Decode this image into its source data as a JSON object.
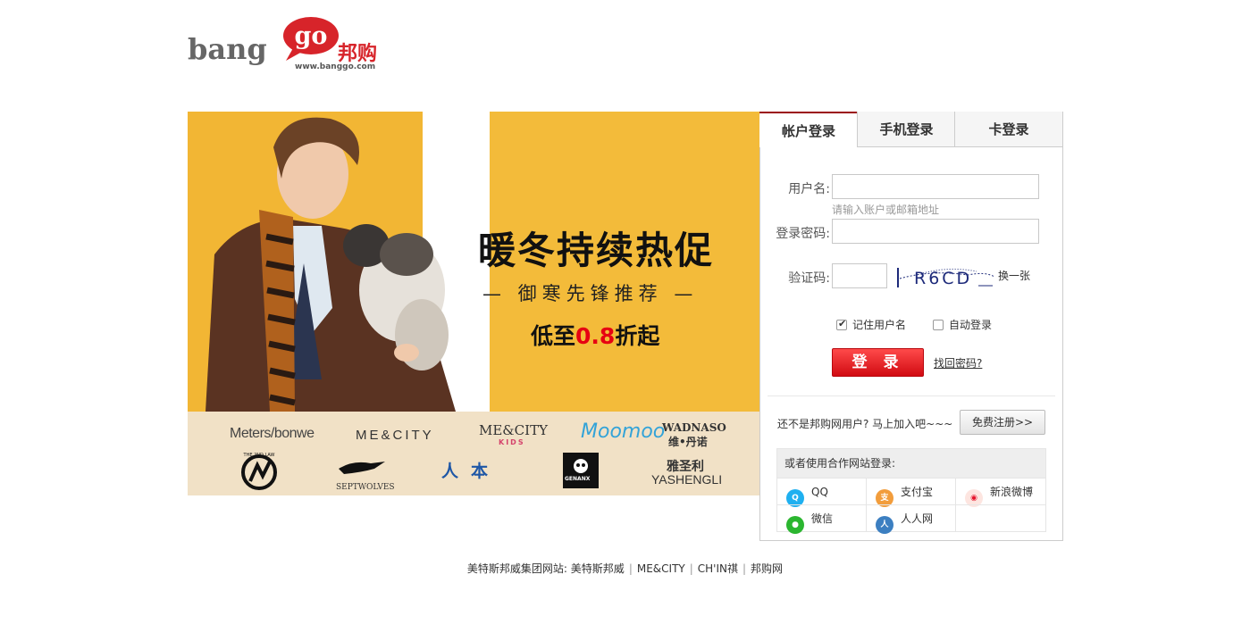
{
  "logo": {
    "wordmark": "bang",
    "bubble_text": "go",
    "chinese": "邦购",
    "url": "www.banggo.com"
  },
  "banner": {
    "headline": "暖冬持续热促",
    "subtitle": "— 御寒先锋推荐 —",
    "price_prefix": "低至",
    "price_value": "0.8",
    "price_suffix": "折起",
    "colors": {
      "background": "#f2b634",
      "accent": "#e60012"
    }
  },
  "brands": {
    "metersbonwe": "Meters/bonwe",
    "mecity": "ME&CITY",
    "mecity_kids_top": "ME&CITY",
    "mecity_kids_bottom": "KIDS",
    "moomoo": "Moomoo",
    "wadnaso_top": "WADNASO",
    "wadnaso_bottom": "维•丹诺",
    "the2ndlaw": "THE 2ND LAW",
    "septwolves": "SEPTWOLVES",
    "renben": "人本",
    "genanx": "GENANX",
    "yashengli_cn": "雅圣利",
    "yashengli_en": "YASHENGLI"
  },
  "login": {
    "tabs": [
      {
        "label": "帐户登录",
        "active": true
      },
      {
        "label": "手机登录",
        "active": false
      },
      {
        "label": "卡登录",
        "active": false
      }
    ],
    "username": {
      "label": "用户名:",
      "value": "",
      "hint": "请输入账户或邮箱地址"
    },
    "password": {
      "label": "登录密码:",
      "value": ""
    },
    "captcha": {
      "label": "验证码:",
      "value": "",
      "image_text": "R6CD",
      "refresh": "换一张"
    },
    "remember": {
      "label": "记住用户名",
      "checked": true
    },
    "autologin": {
      "label": "自动登录",
      "checked": false
    },
    "submit": "登 录",
    "forgot": "找回密码?",
    "register_prompt": "还不是邦购网用户? 马上加入吧~~~",
    "register_button": "免费注册>>",
    "partners_title": "或者使用合作网站登录:",
    "partners": [
      {
        "label": "QQ",
        "icon": "qq-icon",
        "color": "#1fb0f0"
      },
      {
        "label": "支付宝",
        "icon": "alipay-icon",
        "color": "#f29d3c"
      },
      {
        "label": "新浪微博",
        "icon": "weibo-icon",
        "color": "#e6162d"
      },
      {
        "label": "微信",
        "icon": "wechat-icon",
        "color": "#2bb630"
      },
      {
        "label": "人人网",
        "icon": "renren-icon",
        "color": "#3c7fc1"
      }
    ]
  },
  "footer": {
    "prefix": "美特斯邦威集团网站:",
    "links": [
      "美特斯邦威",
      "ME&CITY",
      "CH'IN祺",
      "邦购网"
    ]
  }
}
